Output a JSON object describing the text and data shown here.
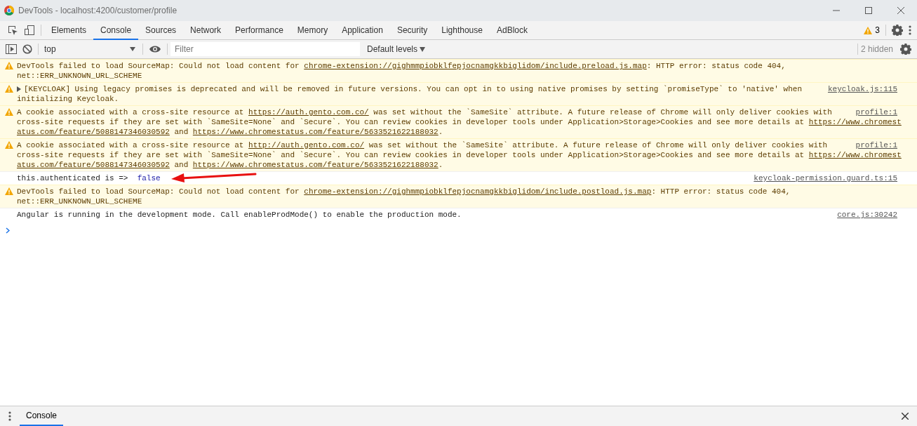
{
  "window": {
    "title": "DevTools - localhost:4200/customer/profile"
  },
  "tabs": [
    {
      "label": "Elements",
      "selected": false
    },
    {
      "label": "Console",
      "selected": true
    },
    {
      "label": "Sources",
      "selected": false
    },
    {
      "label": "Network",
      "selected": false
    },
    {
      "label": "Performance",
      "selected": false
    },
    {
      "label": "Memory",
      "selected": false
    },
    {
      "label": "Application",
      "selected": false
    },
    {
      "label": "Security",
      "selected": false
    },
    {
      "label": "Lighthouse",
      "selected": false
    },
    {
      "label": "AdBlock",
      "selected": false
    }
  ],
  "warning_count": "3",
  "toolbar": {
    "context": "top",
    "filter": {
      "placeholder": "Filter"
    },
    "levels": "Default levels",
    "hidden": "2 hidden"
  },
  "messages": [
    {
      "kind": "warning",
      "lines": [
        [
          {
            "kind": "text",
            "text": "DevTools failed to load SourceMap: Could not load content for "
          },
          {
            "kind": "link",
            "text": "chrome-extension://gighmmpiobklfepjocnamgkkbiglidom/include.preload.js.map"
          },
          {
            "kind": "text",
            "text": ": HTTP error: status code 404,"
          }
        ],
        [
          {
            "kind": "text",
            "text": "net::ERR_UNKNOWN_URL_SCHEME"
          }
        ]
      ]
    },
    {
      "kind": "warning",
      "expanded": false,
      "source": "keycloak.js:115",
      "lines": [
        [
          {
            "kind": "text",
            "text": "[KEYCLOAK] Using legacy promises is deprecated and will be removed in future versions. You can opt in to using native promises by setting `promiseType` to 'native' when"
          }
        ],
        [
          {
            "kind": "text",
            "text": "initializing Keycloak."
          }
        ]
      ]
    },
    {
      "kind": "warning",
      "source": "profile:1",
      "lines": [
        [
          {
            "kind": "text",
            "text": "A cookie associated with a cross-site resource at "
          },
          {
            "kind": "link",
            "text": "https://auth.gento.com.co/"
          },
          {
            "kind": "text",
            "text": " was set without the `SameSite` attribute. A future release of Chrome will only deliver cookies with"
          }
        ],
        [
          {
            "kind": "text",
            "text": "cross-site requests if they are set with `SameSite=None` and `Secure`. You can review cookies in developer tools under Application>Storage>Cookies and see more details at "
          },
          {
            "kind": "link",
            "text": "https://www.chromest"
          }
        ],
        [
          {
            "kind": "link",
            "text": "atus.com/feature/5088147346030592"
          },
          {
            "kind": "text",
            "text": " and "
          },
          {
            "kind": "link",
            "text": "https://www.chromestatus.com/feature/5633521622188032"
          },
          {
            "kind": "text",
            "text": "."
          }
        ]
      ]
    },
    {
      "kind": "warning",
      "source": "profile:1",
      "lines": [
        [
          {
            "kind": "text",
            "text": "A cookie associated with a cross-site resource at "
          },
          {
            "kind": "link",
            "text": "http://auth.gento.com.co/"
          },
          {
            "kind": "text",
            "text": " was set without the `SameSite` attribute. A future release of Chrome will only deliver cookies with"
          }
        ],
        [
          {
            "kind": "text",
            "text": "cross-site requests if they are set with `SameSite=None` and `Secure`. You can review cookies in developer tools under Application>Storage>Cookies and see more details at "
          },
          {
            "kind": "link",
            "text": "https://www.chromest"
          }
        ],
        [
          {
            "kind": "link",
            "text": "atus.com/feature/5088147346030592"
          },
          {
            "kind": "text",
            "text": " and "
          },
          {
            "kind": "link",
            "text": "https://www.chromestatus.com/feature/5633521622188032"
          },
          {
            "kind": "text",
            "text": "."
          }
        ]
      ]
    },
    {
      "kind": "log",
      "source": "keycloak-permission.guard.ts:15",
      "arrow": true,
      "lines": [
        [
          {
            "kind": "text",
            "text": "this.authenticated is =>  "
          },
          {
            "kind": "value",
            "text": "false"
          }
        ]
      ]
    },
    {
      "kind": "warning",
      "lines": [
        [
          {
            "kind": "text",
            "text": "DevTools failed to load SourceMap: Could not load content for "
          },
          {
            "kind": "link",
            "text": "chrome-extension://gighmmpiobklfepjocnamgkkbiglidom/include.postload.js.map"
          },
          {
            "kind": "text",
            "text": ": HTTP error: status code 404,"
          }
        ],
        [
          {
            "kind": "text",
            "text": "net::ERR_UNKNOWN_URL_SCHEME"
          }
        ]
      ]
    },
    {
      "kind": "log",
      "source": "core.js:30242",
      "lines": [
        [
          {
            "kind": "text",
            "text": "Angular is running in the development mode. Call enableProdMode() to enable the production mode."
          }
        ]
      ]
    }
  ],
  "drawer": {
    "tabs": [
      {
        "label": "Console",
        "selected": true
      }
    ]
  }
}
